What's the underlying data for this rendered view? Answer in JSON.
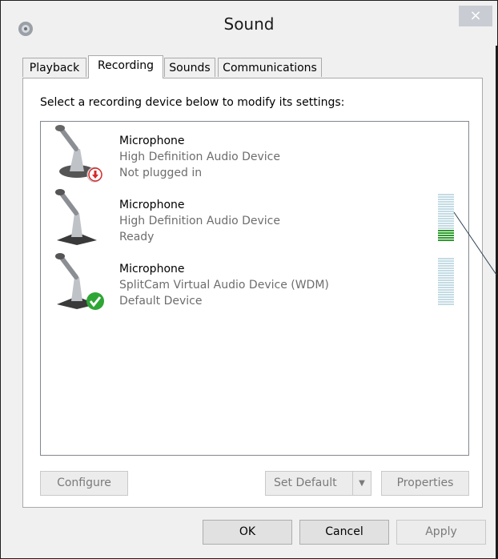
{
  "window": {
    "title": "Sound",
    "close_symbol": "×"
  },
  "tabs": [
    {
      "label": "Playback"
    },
    {
      "label": "Recording"
    },
    {
      "label": "Sounds"
    },
    {
      "label": "Communications"
    }
  ],
  "recording": {
    "instruction": "Select a recording device below to modify its settings:",
    "devices": [
      {
        "name": "Microphone",
        "description": "High Definition Audio Device",
        "status": "Not plugged in",
        "badge": "unplugged-icon"
      },
      {
        "name": "Microphone",
        "description": "High Definition Audio Device",
        "status": "Ready",
        "level": 0.25
      },
      {
        "name": "Microphone",
        "description": "SplitCam Virtual Audio Device (WDM)",
        "status": "Default Device",
        "badge": "default-check-icon",
        "level": 0
      }
    ]
  },
  "buttons": {
    "configure": "Configure",
    "set_default": "Set Default",
    "properties": "Properties",
    "ok": "OK",
    "cancel": "Cancel",
    "apply": "Apply"
  },
  "colors": {
    "meter_inactive": "#c4dce4",
    "meter_active": "#2e9b2e",
    "check_green": "#2ea636",
    "unplug_red": "#d62828"
  }
}
